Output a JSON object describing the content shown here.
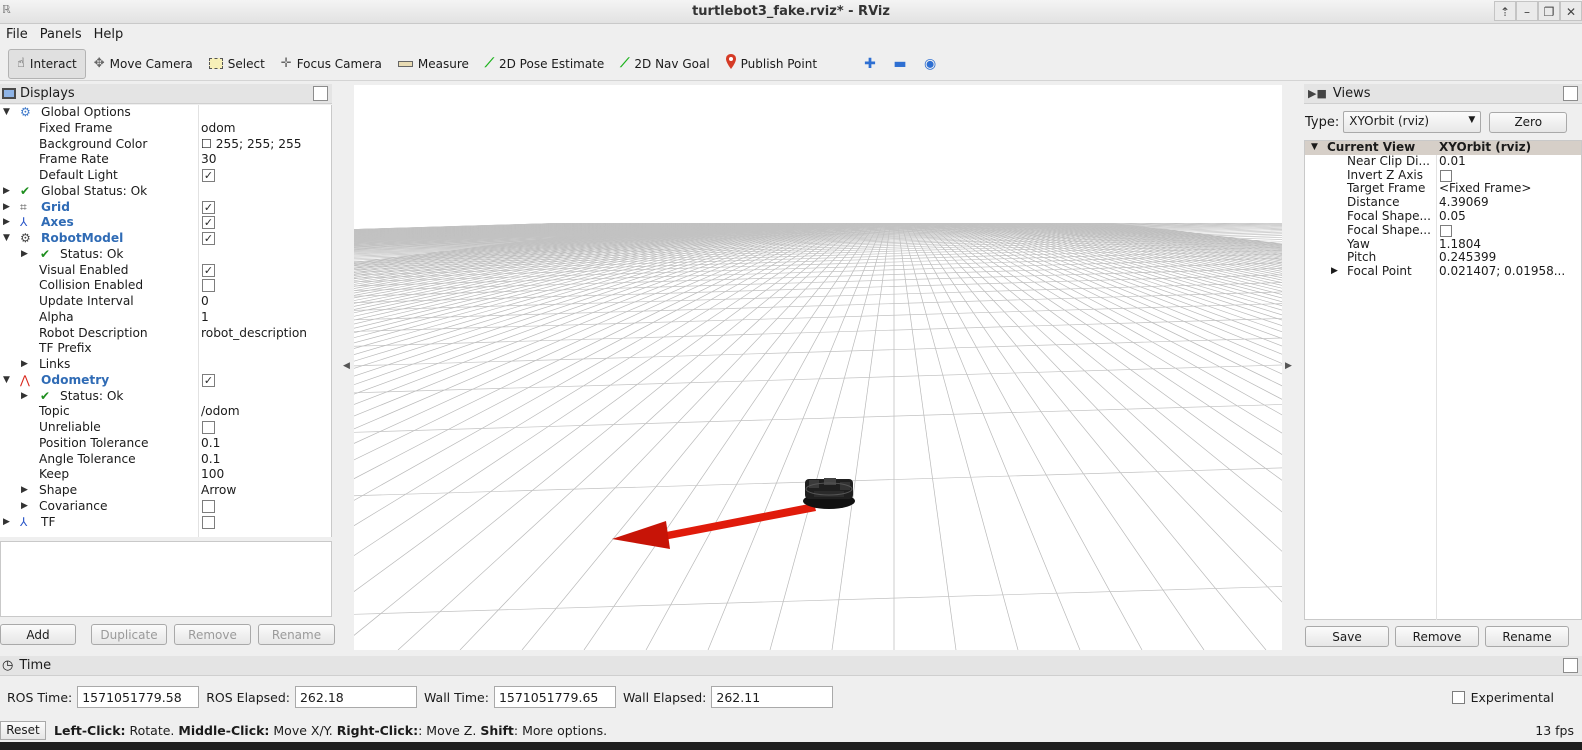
{
  "window": {
    "title": "turtlebot3_fake.rviz* - RViz",
    "controls": [
      "⇡",
      "–",
      "❐",
      "✕"
    ]
  },
  "menu": [
    "File",
    "Panels",
    "Help"
  ],
  "toolbar": {
    "tools": [
      {
        "label": "Interact",
        "icon": "hand-icon"
      },
      {
        "label": "Move Camera",
        "icon": "move-camera-icon"
      },
      {
        "label": "Select",
        "icon": "select-icon"
      },
      {
        "label": "Focus Camera",
        "icon": "focus-camera-icon"
      },
      {
        "label": "Measure",
        "icon": "measure-icon"
      },
      {
        "label": "2D Pose Estimate",
        "icon": "pose-estimate-icon"
      },
      {
        "label": "2D Nav Goal",
        "icon": "nav-goal-icon"
      },
      {
        "label": "Publish Point",
        "icon": "publish-point-icon"
      }
    ]
  },
  "displays": {
    "title": "Displays",
    "rows": [
      {
        "indent": 0,
        "arrow": "open",
        "icon": "gear",
        "label": "Global Options",
        "style": ""
      },
      {
        "indent": 1,
        "label": "Fixed Frame",
        "value": "odom"
      },
      {
        "indent": 1,
        "label": "Background Color",
        "value": "☐ 255; 255; 255"
      },
      {
        "indent": 1,
        "label": "Frame Rate",
        "value": "30"
      },
      {
        "indent": 1,
        "label": "Default Light",
        "check": "✓"
      },
      {
        "indent": 0,
        "arrow": "closed",
        "icon": "check",
        "label": "Global Status: Ok"
      },
      {
        "indent": 0,
        "arrow": "closed",
        "icon": "grid",
        "label": "Grid",
        "style": "blue",
        "check": "✓"
      },
      {
        "indent": 0,
        "arrow": "closed",
        "icon": "axes",
        "label": "Axes",
        "style": "blue",
        "check": "✓"
      },
      {
        "indent": 0,
        "arrow": "open",
        "icon": "robot",
        "label": "RobotModel",
        "style": "blue",
        "check": "✓"
      },
      {
        "indent": 1,
        "arrow": "closed",
        "icon": "check",
        "label": "Status: Ok"
      },
      {
        "indent": 1,
        "label": "Visual Enabled",
        "check": "✓"
      },
      {
        "indent": 1,
        "label": "Collision Enabled",
        "check": ""
      },
      {
        "indent": 1,
        "label": "Update Interval",
        "value": "0"
      },
      {
        "indent": 1,
        "label": "Alpha",
        "value": "1"
      },
      {
        "indent": 1,
        "label": "Robot Description",
        "value": "robot_description"
      },
      {
        "indent": 1,
        "label": "TF Prefix",
        "value": ""
      },
      {
        "indent": 1,
        "arrow": "closed",
        "label": "Links"
      },
      {
        "indent": 0,
        "arrow": "open",
        "icon": "odom",
        "label": "Odometry",
        "style": "blue",
        "check": "✓"
      },
      {
        "indent": 1,
        "arrow": "closed",
        "icon": "check",
        "label": "Status: Ok"
      },
      {
        "indent": 1,
        "label": "Topic",
        "value": "/odom"
      },
      {
        "indent": 1,
        "label": "Unreliable",
        "check": ""
      },
      {
        "indent": 1,
        "label": "Position Tolerance",
        "value": "0.1"
      },
      {
        "indent": 1,
        "label": "Angle Tolerance",
        "value": "0.1"
      },
      {
        "indent": 1,
        "label": "Keep",
        "value": "100"
      },
      {
        "indent": 1,
        "arrow": "closed",
        "label": "Shape",
        "value": "Arrow"
      },
      {
        "indent": 1,
        "arrow": "closed",
        "label": "Covariance",
        "check": ""
      },
      {
        "indent": 0,
        "arrow": "closed",
        "icon": "tf",
        "label": "TF",
        "check": ""
      }
    ],
    "buttons": {
      "add": "Add",
      "duplicate": "Duplicate",
      "remove": "Remove",
      "rename": "Rename"
    }
  },
  "views": {
    "title": "Views",
    "type_label": "Type:",
    "type_value": "XYOrbit (rviz)",
    "zero": "Zero",
    "current_view": {
      "label": "Current View",
      "value": "XYOrbit (rviz)"
    },
    "props": [
      {
        "label": "Near Clip Di...",
        "value": "0.01"
      },
      {
        "label": "Invert Z Axis",
        "check": true
      },
      {
        "label": "Target Frame",
        "value": "<Fixed Frame>"
      },
      {
        "label": "Distance",
        "value": "4.39069"
      },
      {
        "label": "Focal Shape...",
        "value": "0.05"
      },
      {
        "label": "Focal Shape...",
        "check": true
      },
      {
        "label": "Yaw",
        "value": "1.1804"
      },
      {
        "label": "Pitch",
        "value": "0.245399"
      },
      {
        "label": "Focal Point",
        "value": "0.021407; 0.01958...",
        "arrow": true
      }
    ],
    "buttons": {
      "save": "Save",
      "remove": "Remove",
      "rename": "Rename"
    }
  },
  "time": {
    "title": "Time",
    "ros_time_label": "ROS Time:",
    "ros_time": "1571051779.58",
    "ros_elapsed_label": "ROS Elapsed:",
    "ros_elapsed": "262.18",
    "wall_time_label": "Wall Time:",
    "wall_time": "1571051779.65",
    "wall_elapsed_label": "Wall Elapsed:",
    "wall_elapsed": "262.11",
    "experimental": "Experimental"
  },
  "status": {
    "reset": "Reset",
    "h1": "Left-Click:",
    "t1": " Rotate. ",
    "h2": "Middle-Click:",
    "t2": " Move X/Y. ",
    "h3": "Right-Click:",
    "t3": ": Move Z. ",
    "h4": "Shift",
    "t4": ": More options.",
    "fps": "13 fps"
  },
  "colors": {
    "odometry_arrow": "#e01b0b",
    "link_blue": "#2f6bb5",
    "view_header": "#d6cfc8"
  }
}
